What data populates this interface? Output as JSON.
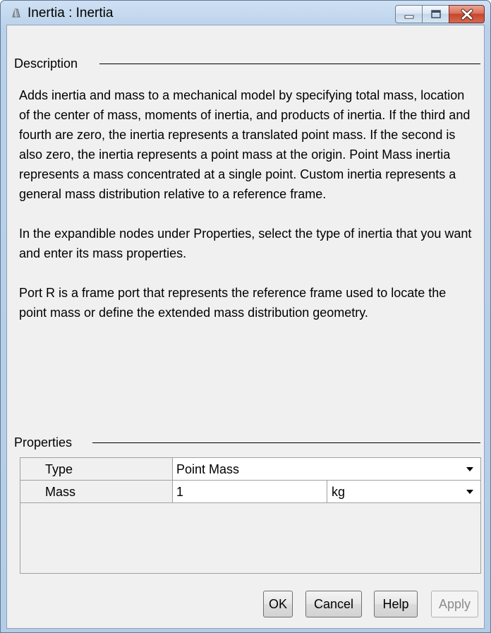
{
  "window": {
    "title": "Inertia : Inertia",
    "icon": "inertia-app-icon"
  },
  "description": {
    "group_label": "Description",
    "paragraphs": [
      "Adds inertia and mass to a mechanical model by specifying total mass, location of the center of mass, moments of inertia, and products of inertia. If the third and fourth are zero, the inertia represents a translated point mass. If the second is also zero, the inertia represents a point mass at the origin. Point Mass inertia represents a mass concentrated at a single point. Custom inertia represents a general mass distribution relative to a reference frame.",
      "In the expandible nodes under Properties, select the type of inertia that you want and enter its mass properties.",
      "Port R is a frame port that represents the reference frame used to locate the point mass or define the extended mass distribution geometry."
    ]
  },
  "properties": {
    "group_label": "Properties",
    "rows": [
      {
        "name": "Type",
        "value": "Point Mass"
      },
      {
        "name": "Mass",
        "value": "1",
        "unit": "kg"
      }
    ]
  },
  "buttons": {
    "ok": "OK",
    "cancel": "Cancel",
    "help": "Help",
    "apply": "Apply"
  },
  "colors": {
    "title_bar": "#b9d1ea",
    "close_button": "#c8452c",
    "client_bg": "#f0f0f0"
  }
}
